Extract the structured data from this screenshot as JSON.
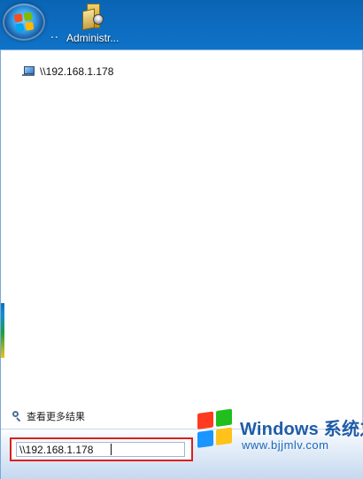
{
  "desktop": {
    "start_button_icon": "windows-start-orb-icon",
    "dots": "..",
    "folder_label": "Administr...",
    "folder_icon": "administrator-folder-icon"
  },
  "start_menu": {
    "results": [
      {
        "icon": "computer-icon",
        "label": "\\\\192.168.1.178"
      }
    ],
    "see_more": {
      "icon": "search-icon",
      "label": "查看更多结果"
    },
    "search": {
      "value": "\\\\192.168.1.178"
    }
  },
  "watermark": {
    "logo_icon": "windows-logo-icon",
    "title": "Windows 系统之家",
    "url": "www.bjjmlv.com"
  },
  "colors": {
    "desktop_blue": "#0f79cf",
    "highlight_red": "#d8211d",
    "watermark_blue": "#1e5da8"
  }
}
